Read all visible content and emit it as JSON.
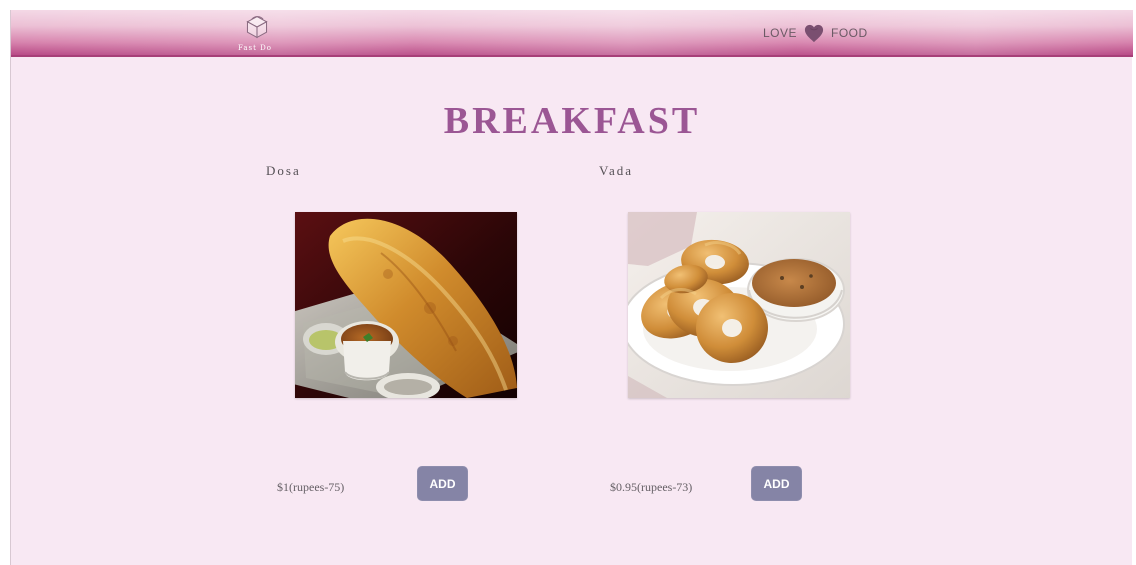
{
  "header": {
    "logo_text": "Fast Do",
    "love_label": "LOVE",
    "food_label": "FOOD",
    "logo_icon": "fast-food-box-icon",
    "heart_icon": "heart-icon",
    "brand_color": "#b84a86"
  },
  "page": {
    "title": "BREAKFAST",
    "title_color": "#9b5694",
    "background_color": "#f8e8f3"
  },
  "items": [
    {
      "name": "Dosa",
      "price": "$1(rupees-75)",
      "add_label": "ADD"
    },
    {
      "name": "Vada",
      "price": "$0.95(rupees-73)",
      "add_label": "ADD"
    }
  ],
  "button_color": "#8584a6"
}
